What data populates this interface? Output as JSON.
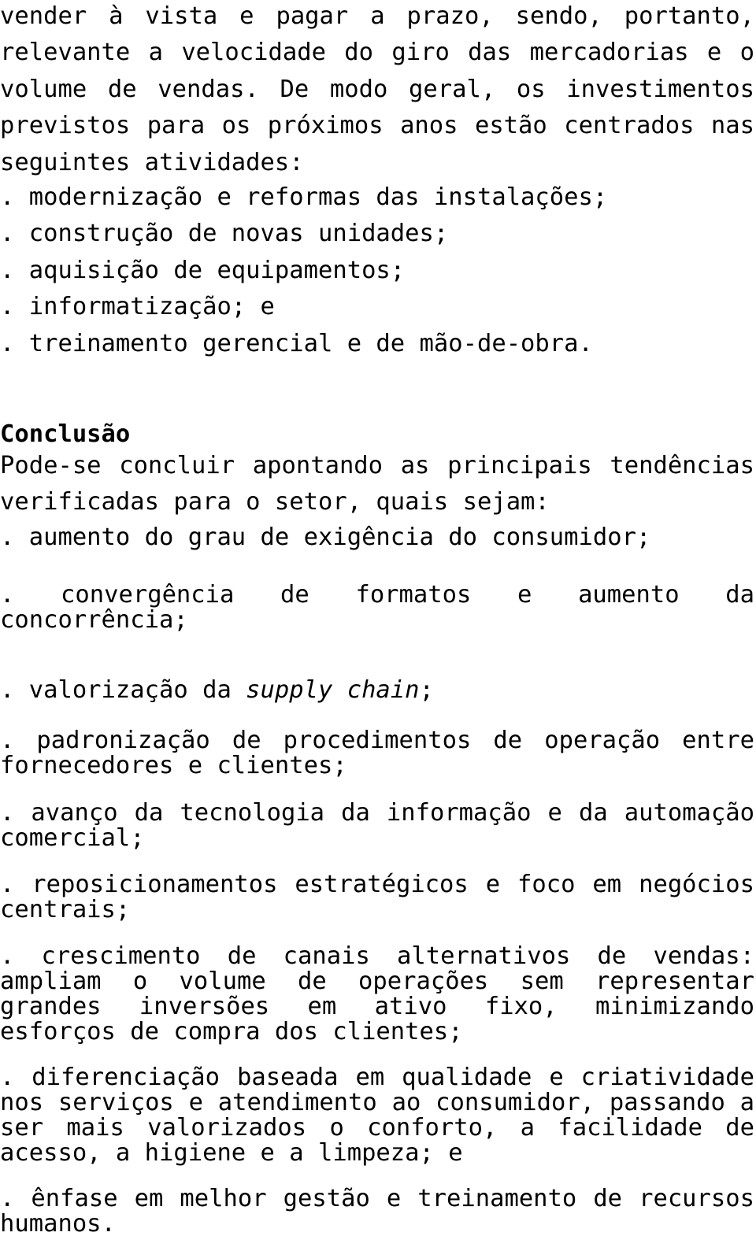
{
  "document": {
    "language": "pt-BR",
    "body_paragraph": "vender à vista e pagar a prazo, sendo, portanto, relevante a velocidade do giro  das mercadorias e o volume de vendas. De modo geral, os investimentos previstos para os próximos anos estão centrados nas seguintes atividades:",
    "investment_list": [
      ". modernização e reformas das instalações;",
      ". construção de novas unidades;",
      ". aquisição de equipamentos;",
      ". informatização; e",
      ". treinamento gerencial e de mão-de-obra."
    ],
    "conclusion": {
      "heading": "Conclusão",
      "intro": "Pode-se concluir apontando as principais tendências verificadas para o setor, quais sejam:",
      "trends": [
        {
          "text": ". aumento do grau de exigência do consumidor;",
          "spacing": "wide",
          "italic_run": ""
        },
        {
          "text": ". convergência de formatos e aumento da concorrência;",
          "spacing": "tight",
          "italic_run": ""
        },
        {
          "text": ". valorização da supply chain;",
          "spacing": "tight",
          "italic_run": "supply chain"
        },
        {
          "text": ". padronização de procedimentos de operação entre fornecedores e clientes;",
          "spacing": "tight",
          "italic_run": ""
        },
        {
          "text": ". avanço da tecnologia da informação e da automação comercial;",
          "spacing": "tight",
          "italic_run": ""
        },
        {
          "text": ". reposicionamentos estratégicos e foco em negócios centrais;",
          "spacing": "tight",
          "italic_run": ""
        },
        {
          "text": ". crescimento de canais alternativos de vendas: ampliam o volume de operações sem representar grandes inversões em ativo fixo, minimizando esforços de compra dos clientes;",
          "spacing": "tight",
          "italic_run": ""
        },
        {
          "text": ". diferenciação baseada em qualidade e criatividade nos serviços e atendimento ao consumidor, passando a ser mais valorizados o conforto, a facilidade de acesso, a higiene e a limpeza; e",
          "spacing": "tight",
          "italic_run": ""
        },
        {
          "text": ". ênfase em melhor gestão e treinamento de recursos humanos.",
          "spacing": "tight",
          "italic_run": ""
        }
      ]
    }
  }
}
